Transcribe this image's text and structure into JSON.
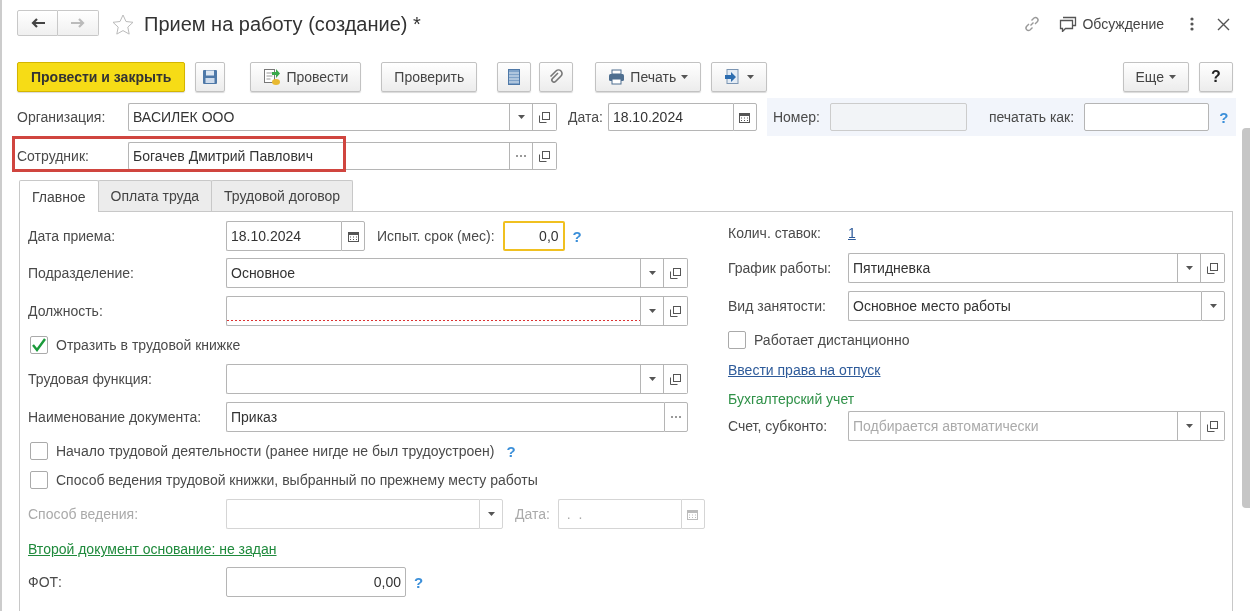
{
  "window": {
    "title": "Прием на работу (создание) *",
    "favorite": false
  },
  "header": {
    "discussion": "Обсуждение"
  },
  "toolbar": {
    "post_and_close": "Провести и закрыть",
    "post": "Провести",
    "check": "Проверить",
    "print": "Печать",
    "more": "Еще",
    "help": "?"
  },
  "organization": {
    "label": "Организация:",
    "value": "ВАСИЛЕК ООО"
  },
  "date": {
    "label": "Дата:",
    "value": "18.10.2024"
  },
  "number": {
    "label": "Номер:"
  },
  "print_as": {
    "label": "печатать как:",
    "help": "?"
  },
  "employee": {
    "label": "Сотрудник:",
    "value": "Богачев Дмитрий Павлович",
    "highlighted": true
  },
  "tabs": [
    {
      "label": "Главное",
      "selected": true
    },
    {
      "label": "Оплата труда",
      "selected": false
    },
    {
      "label": "Трудовой договор",
      "selected": false
    }
  ],
  "main_tab": {
    "hire_date": {
      "label": "Дата приема:",
      "value": "18.10.2024"
    },
    "probation": {
      "label": "Испыт. срок (мес):",
      "value": "0,0",
      "focused": true,
      "help": "?"
    },
    "department": {
      "label": "Подразделение:",
      "value": "Основное"
    },
    "position": {
      "label": "Должность:",
      "required": true
    },
    "reflect_in_book": {
      "label": "Отразить в трудовой книжке",
      "checked": true
    },
    "labor_function": {
      "label": "Трудовая функция:"
    },
    "document_name": {
      "label": "Наименование документа:",
      "value": "Приказ"
    },
    "first_job": {
      "label": "Начало трудовой деятельности (ранее нигде не был трудоустроен)",
      "checked": false,
      "help": "?"
    },
    "previous_method": {
      "label": "Способ ведения трудовой книжки, выбранный по прежнему месту работы",
      "checked": false
    },
    "method": {
      "label": "Способ ведения:",
      "disabled": true
    },
    "method_date": {
      "label": "Дата:",
      "placeholder": " .  .",
      "disabled": true
    },
    "second_document_link": "Второй документ основание: не задан",
    "payroll": {
      "label": "ФОТ:",
      "value": "0,00",
      "help": "?"
    },
    "rates": {
      "label": "Колич. ставок:",
      "value": "1"
    },
    "schedule": {
      "label": "График работы:",
      "value": "Пятидневка"
    },
    "employment_type": {
      "label": "Вид занятости:",
      "value": "Основное место работы"
    },
    "remote": {
      "label": "Работает дистанционно",
      "checked": false
    },
    "vacation_link": "Ввести права на отпуск",
    "accounting_heading": "Бухгалтерский учет",
    "account": {
      "label": "Счет, субконто:",
      "placeholder": "Подбирается автоматически"
    }
  }
}
